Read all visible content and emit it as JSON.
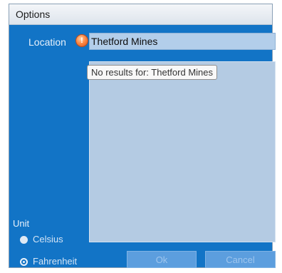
{
  "window": {
    "title": "Options"
  },
  "location": {
    "label": "Location",
    "value": "Thetford Mines",
    "status_icon": "warning-orb-icon"
  },
  "results": {
    "tooltip": "No results for: Thetford Mines"
  },
  "unit": {
    "label": "Unit",
    "options": [
      "Celsius",
      "Fahrenheit"
    ],
    "selected": "Fahrenheit"
  },
  "buttons": {
    "ok_label": "Ok",
    "cancel_label": "Cancel"
  },
  "colors": {
    "accent": "#1274c6",
    "warning": "#ff8a45"
  }
}
